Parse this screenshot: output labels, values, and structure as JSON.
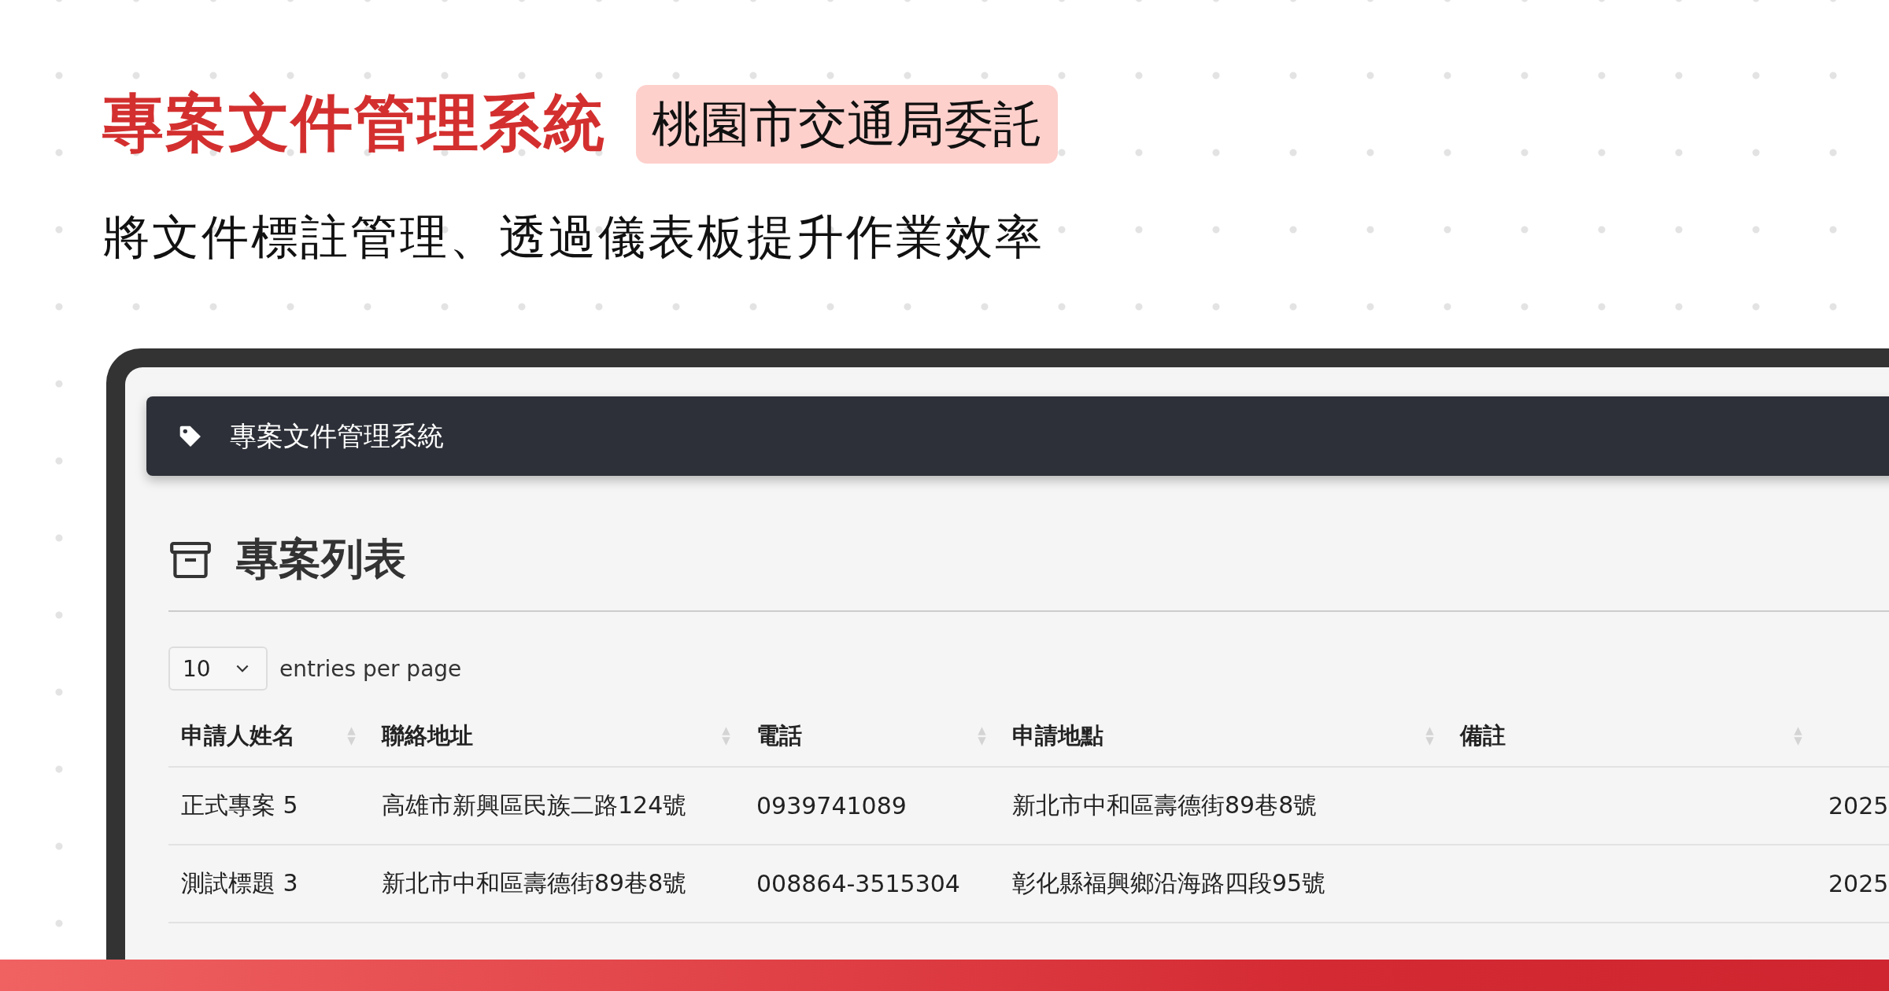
{
  "headline": {
    "title": "專案文件管理系統",
    "badge": "桃園市交通局委託",
    "subtitle": "將文件標註管理、透過儀表板提升作業效率"
  },
  "app": {
    "navbar_title": "專案文件管理系統",
    "page_title": "專案列表",
    "page_size": "10",
    "page_size_label": "entries per page",
    "columns": [
      "申請人姓名",
      "聯絡地址",
      "電話",
      "申請地點",
      "備註"
    ],
    "rows": [
      [
        "正式專案 5",
        "高雄市新興區民族二路124號",
        "0939741089",
        "新北市中和區壽德街89巷8號",
        "",
        "2025"
      ],
      [
        "測試標題 3",
        "新北市中和區壽德街89巷8號",
        "008864-3515304",
        "彰化縣福興鄉沿海路四段95號",
        "",
        "2025"
      ]
    ]
  }
}
